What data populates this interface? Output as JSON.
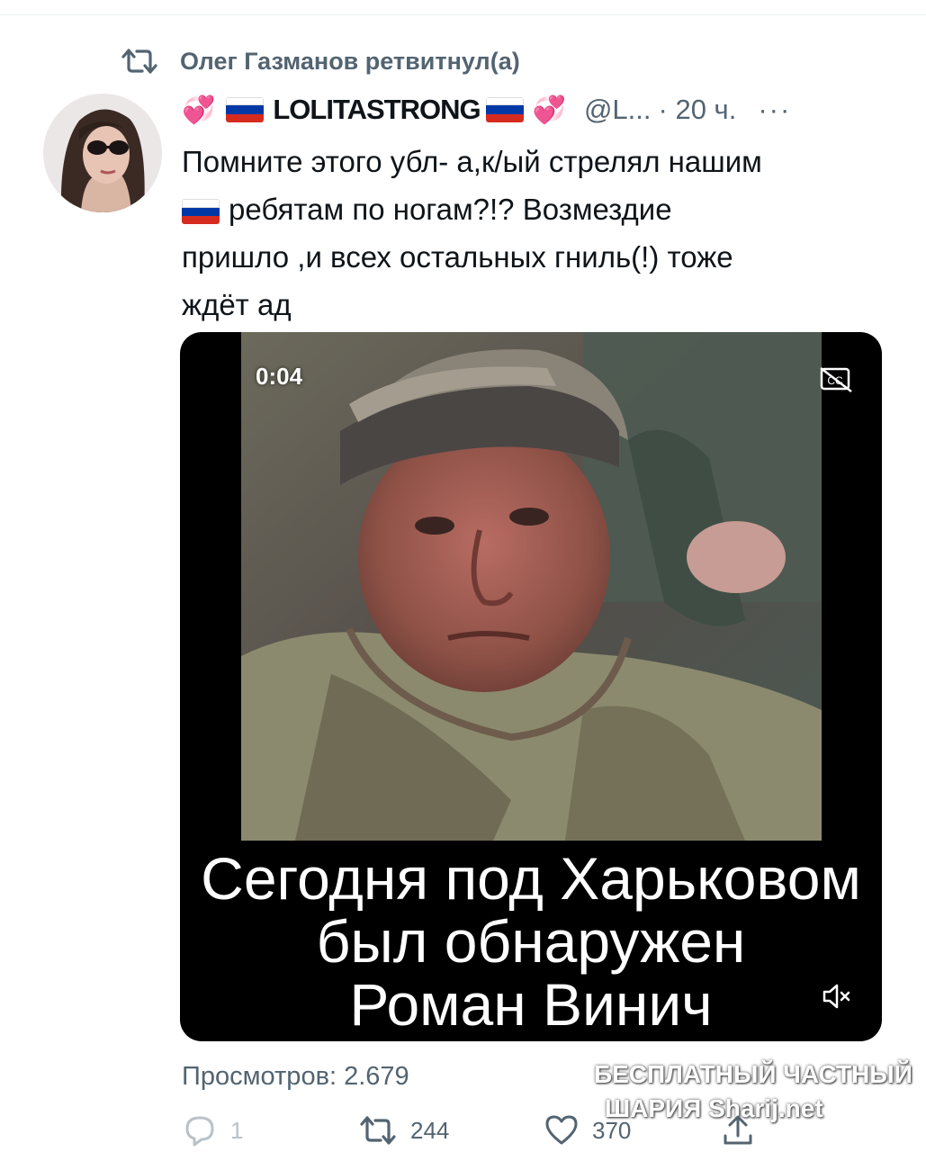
{
  "retweet": {
    "text": "Олег Газманов ретвитнул(а)"
  },
  "tweet": {
    "author_name": "LOLITASTRONG",
    "handle": "@L...",
    "time": "· 20 ч.",
    "more": "···",
    "text_lines": [
      "Помните этого убл- а,к/ый стрелял нашим",
      "ребятам по ногам?!? Возмездие",
      "пришло ,и всех остальных гниль(!)  тоже",
      "ждёт ад"
    ]
  },
  "video": {
    "timer": "0:04",
    "caption_lines": [
      "Сегодня под Харьковом",
      "был обнаружен",
      "Роман Винич"
    ]
  },
  "views": "Просмотров: 2.679",
  "actions": {
    "replies": "1",
    "retweets": "244",
    "likes": "370"
  },
  "watermark": {
    "line1": "БЕСПЛАТНЫЙ ЧАСТНЫЙ",
    "line2": "ШАРИЯ Sharij.net"
  },
  "colors": {
    "secondary_text": "#536471",
    "heart_emoji": "#e0478d",
    "flag_white": "#ffffff",
    "flag_blue": "#0039a6",
    "flag_red": "#d52b1e"
  },
  "icons": [
    "retweet-icon",
    "sparkling-heart-emoji",
    "russia-flag-emoji",
    "closed-captions-icon",
    "mute-icon",
    "reply-icon",
    "like-icon",
    "share-icon"
  ]
}
